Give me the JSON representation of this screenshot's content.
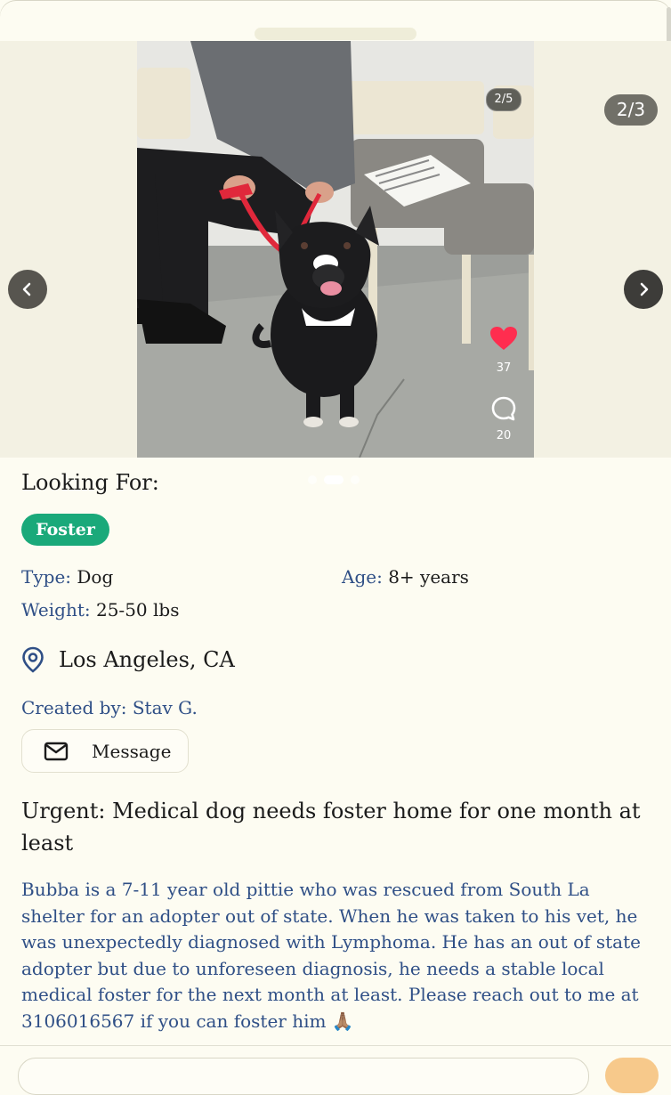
{
  "carousel": {
    "image_counter": "2/5",
    "post_counter": "2/3",
    "likes": "37",
    "comments": "20",
    "current_dot": 2,
    "dot_count": 3
  },
  "looking_for": {
    "label": "Looking For:",
    "badge": "Foster",
    "badge_color": "#1aa97a"
  },
  "details": {
    "type_label": "Type:",
    "type_value": "Dog",
    "age_label": "Age:",
    "age_value": "8+ years",
    "weight_label": "Weight:",
    "weight_value": "25-50 lbs"
  },
  "location": {
    "icon": "location-pin-icon",
    "text": "Los Angeles, CA"
  },
  "creator": {
    "label": "Created by:",
    "name": "Stav G."
  },
  "message_button": {
    "icon": "envelope-icon",
    "label": "Message"
  },
  "post": {
    "title": "Urgent: Medical dog needs foster home for one month at least",
    "body": "Bubba is a 7-11 year old pittie who was rescued from South La shelter for an adopter out of state. When he was taken to his vet, he was unexpectedly diagnosed with Lymphoma. He has an out of state adopter but due to unforeseen diagnosis, he needs a stable local medical foster for the next month at least. Please reach out to me at 3106016567 if you can foster him 🙏🏽"
  },
  "colors": {
    "background": "#fdfcf2",
    "accent_text": "#2f4f86",
    "like_heart": "#ff2d4f"
  }
}
